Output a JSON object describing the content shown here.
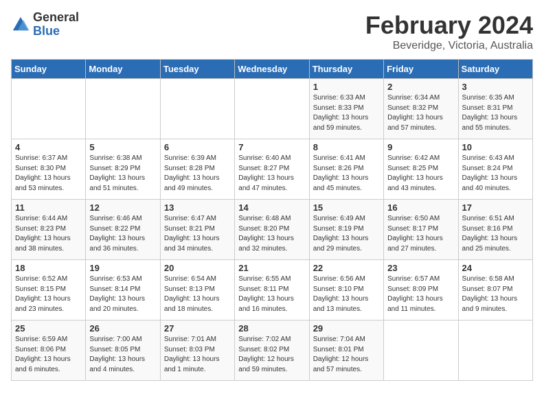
{
  "logo": {
    "general": "General",
    "blue": "Blue"
  },
  "title": {
    "month_year": "February 2024",
    "location": "Beveridge, Victoria, Australia"
  },
  "weekdays": [
    "Sunday",
    "Monday",
    "Tuesday",
    "Wednesday",
    "Thursday",
    "Friday",
    "Saturday"
  ],
  "weeks": [
    [
      {
        "day": "",
        "sunrise": "",
        "sunset": "",
        "daylight": ""
      },
      {
        "day": "",
        "sunrise": "",
        "sunset": "",
        "daylight": ""
      },
      {
        "day": "",
        "sunrise": "",
        "sunset": "",
        "daylight": ""
      },
      {
        "day": "",
        "sunrise": "",
        "sunset": "",
        "daylight": ""
      },
      {
        "day": "1",
        "sunrise": "Sunrise: 6:33 AM",
        "sunset": "Sunset: 8:33 PM",
        "daylight": "Daylight: 13 hours and 59 minutes."
      },
      {
        "day": "2",
        "sunrise": "Sunrise: 6:34 AM",
        "sunset": "Sunset: 8:32 PM",
        "daylight": "Daylight: 13 hours and 57 minutes."
      },
      {
        "day": "3",
        "sunrise": "Sunrise: 6:35 AM",
        "sunset": "Sunset: 8:31 PM",
        "daylight": "Daylight: 13 hours and 55 minutes."
      }
    ],
    [
      {
        "day": "4",
        "sunrise": "Sunrise: 6:37 AM",
        "sunset": "Sunset: 8:30 PM",
        "daylight": "Daylight: 13 hours and 53 minutes."
      },
      {
        "day": "5",
        "sunrise": "Sunrise: 6:38 AM",
        "sunset": "Sunset: 8:29 PM",
        "daylight": "Daylight: 13 hours and 51 minutes."
      },
      {
        "day": "6",
        "sunrise": "Sunrise: 6:39 AM",
        "sunset": "Sunset: 8:28 PM",
        "daylight": "Daylight: 13 hours and 49 minutes."
      },
      {
        "day": "7",
        "sunrise": "Sunrise: 6:40 AM",
        "sunset": "Sunset: 8:27 PM",
        "daylight": "Daylight: 13 hours and 47 minutes."
      },
      {
        "day": "8",
        "sunrise": "Sunrise: 6:41 AM",
        "sunset": "Sunset: 8:26 PM",
        "daylight": "Daylight: 13 hours and 45 minutes."
      },
      {
        "day": "9",
        "sunrise": "Sunrise: 6:42 AM",
        "sunset": "Sunset: 8:25 PM",
        "daylight": "Daylight: 13 hours and 43 minutes."
      },
      {
        "day": "10",
        "sunrise": "Sunrise: 6:43 AM",
        "sunset": "Sunset: 8:24 PM",
        "daylight": "Daylight: 13 hours and 40 minutes."
      }
    ],
    [
      {
        "day": "11",
        "sunrise": "Sunrise: 6:44 AM",
        "sunset": "Sunset: 8:23 PM",
        "daylight": "Daylight: 13 hours and 38 minutes."
      },
      {
        "day": "12",
        "sunrise": "Sunrise: 6:46 AM",
        "sunset": "Sunset: 8:22 PM",
        "daylight": "Daylight: 13 hours and 36 minutes."
      },
      {
        "day": "13",
        "sunrise": "Sunrise: 6:47 AM",
        "sunset": "Sunset: 8:21 PM",
        "daylight": "Daylight: 13 hours and 34 minutes."
      },
      {
        "day": "14",
        "sunrise": "Sunrise: 6:48 AM",
        "sunset": "Sunset: 8:20 PM",
        "daylight": "Daylight: 13 hours and 32 minutes."
      },
      {
        "day": "15",
        "sunrise": "Sunrise: 6:49 AM",
        "sunset": "Sunset: 8:19 PM",
        "daylight": "Daylight: 13 hours and 29 minutes."
      },
      {
        "day": "16",
        "sunrise": "Sunrise: 6:50 AM",
        "sunset": "Sunset: 8:17 PM",
        "daylight": "Daylight: 13 hours and 27 minutes."
      },
      {
        "day": "17",
        "sunrise": "Sunrise: 6:51 AM",
        "sunset": "Sunset: 8:16 PM",
        "daylight": "Daylight: 13 hours and 25 minutes."
      }
    ],
    [
      {
        "day": "18",
        "sunrise": "Sunrise: 6:52 AM",
        "sunset": "Sunset: 8:15 PM",
        "daylight": "Daylight: 13 hours and 23 minutes."
      },
      {
        "day": "19",
        "sunrise": "Sunrise: 6:53 AM",
        "sunset": "Sunset: 8:14 PM",
        "daylight": "Daylight: 13 hours and 20 minutes."
      },
      {
        "day": "20",
        "sunrise": "Sunrise: 6:54 AM",
        "sunset": "Sunset: 8:13 PM",
        "daylight": "Daylight: 13 hours and 18 minutes."
      },
      {
        "day": "21",
        "sunrise": "Sunrise: 6:55 AM",
        "sunset": "Sunset: 8:11 PM",
        "daylight": "Daylight: 13 hours and 16 minutes."
      },
      {
        "day": "22",
        "sunrise": "Sunrise: 6:56 AM",
        "sunset": "Sunset: 8:10 PM",
        "daylight": "Daylight: 13 hours and 13 minutes."
      },
      {
        "day": "23",
        "sunrise": "Sunrise: 6:57 AM",
        "sunset": "Sunset: 8:09 PM",
        "daylight": "Daylight: 13 hours and 11 minutes."
      },
      {
        "day": "24",
        "sunrise": "Sunrise: 6:58 AM",
        "sunset": "Sunset: 8:07 PM",
        "daylight": "Daylight: 13 hours and 9 minutes."
      }
    ],
    [
      {
        "day": "25",
        "sunrise": "Sunrise: 6:59 AM",
        "sunset": "Sunset: 8:06 PM",
        "daylight": "Daylight: 13 hours and 6 minutes."
      },
      {
        "day": "26",
        "sunrise": "Sunrise: 7:00 AM",
        "sunset": "Sunset: 8:05 PM",
        "daylight": "Daylight: 13 hours and 4 minutes."
      },
      {
        "day": "27",
        "sunrise": "Sunrise: 7:01 AM",
        "sunset": "Sunset: 8:03 PM",
        "daylight": "Daylight: 13 hours and 1 minute."
      },
      {
        "day": "28",
        "sunrise": "Sunrise: 7:02 AM",
        "sunset": "Sunset: 8:02 PM",
        "daylight": "Daylight: 12 hours and 59 minutes."
      },
      {
        "day": "29",
        "sunrise": "Sunrise: 7:04 AM",
        "sunset": "Sunset: 8:01 PM",
        "daylight": "Daylight: 12 hours and 57 minutes."
      },
      {
        "day": "",
        "sunrise": "",
        "sunset": "",
        "daylight": ""
      },
      {
        "day": "",
        "sunrise": "",
        "sunset": "",
        "daylight": ""
      }
    ]
  ],
  "first_week_empty_cols": [
    0,
    1,
    2,
    3
  ],
  "last_week_empty_cols": [
    5,
    6
  ]
}
